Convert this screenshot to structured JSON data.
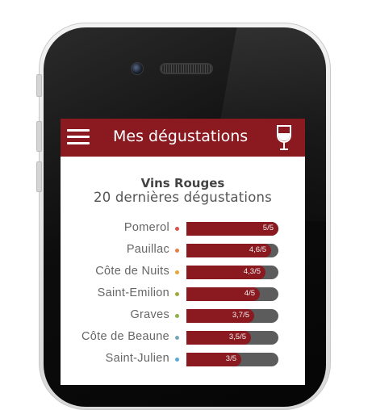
{
  "header": {
    "title": "Mes dégustations",
    "menu_icon": "hamburger-menu-icon",
    "glass_icon": "wine-glass-icon",
    "accent_color": "#8a1a20"
  },
  "section": {
    "title": "Vins Rouges",
    "subtitle": "20 dernières dégustations"
  },
  "ratings": [
    {
      "label": "Pomerol",
      "score": "5/5",
      "value": 1.0,
      "dot_color": "#d9534f"
    },
    {
      "label": "Pauillac",
      "score": "4,6/5",
      "value": 0.92,
      "dot_color": "#e67e45"
    },
    {
      "label": "Côte de Nuits",
      "score": "4,3/5",
      "value": 0.86,
      "dot_color": "#e9a33b"
    },
    {
      "label": "Saint-Emilion",
      "score": "4/5",
      "value": 0.8,
      "dot_color": "#a3a63a"
    },
    {
      "label": "Graves",
      "score": "3,7/5",
      "value": 0.74,
      "dot_color": "#8cb34a"
    },
    {
      "label": "Côte de Beaune",
      "score": "3,5/5",
      "value": 0.7,
      "dot_color": "#7aa7b8"
    },
    {
      "label": "Saint-Julien",
      "score": "3/5",
      "value": 0.6,
      "dot_color": "#5aa9d6"
    }
  ]
}
